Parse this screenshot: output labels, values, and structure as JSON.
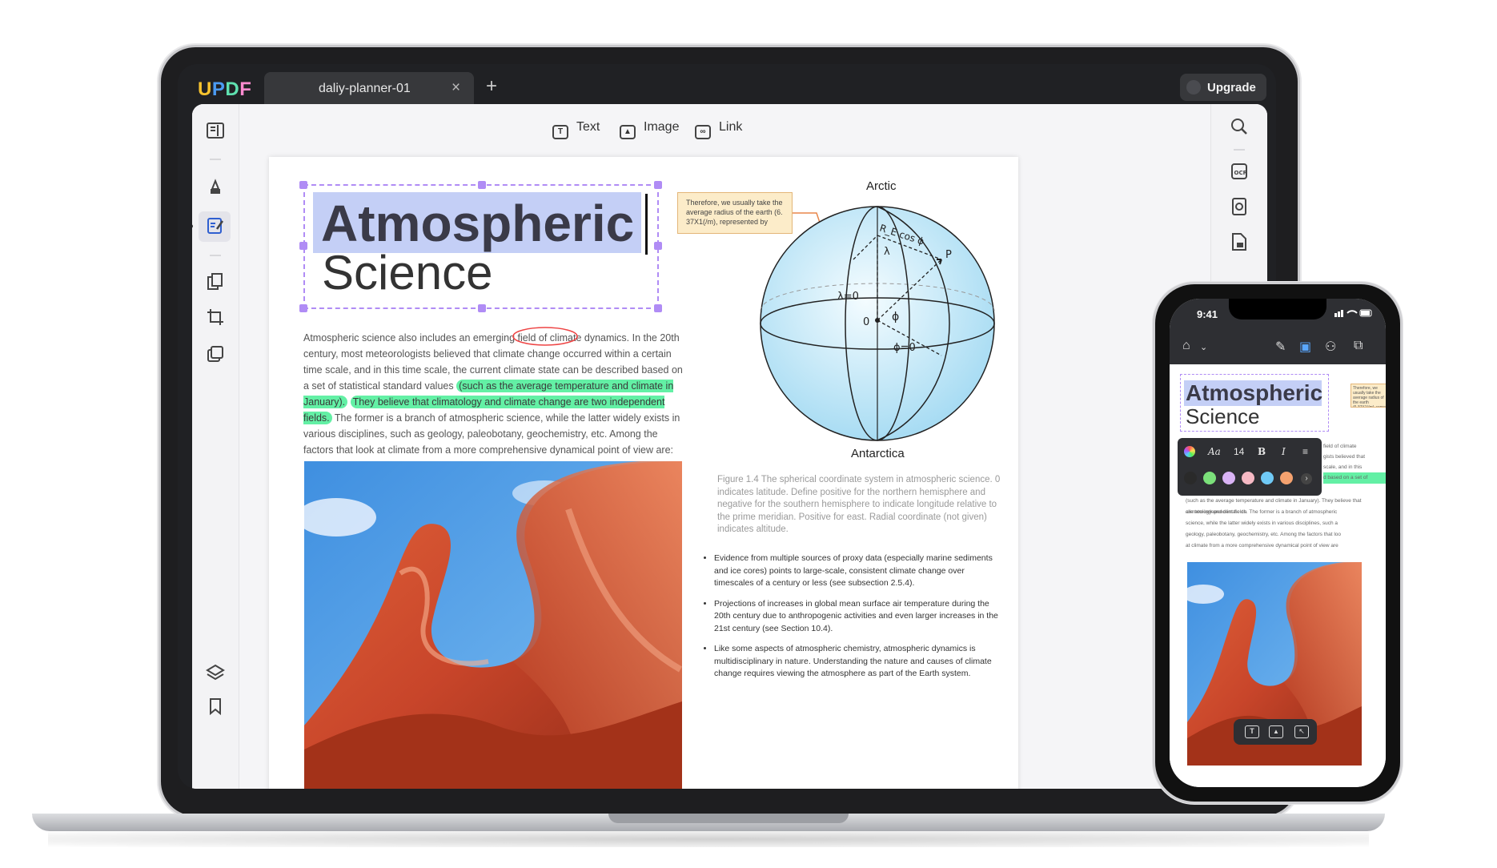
{
  "app": {
    "logo": [
      "U",
      "P",
      "D",
      "F"
    ],
    "logo_colors": [
      "#f7c32e",
      "#4b9bf3",
      "#5fe1b0",
      "#ff8bd0"
    ],
    "tab_title": "daliy-planner-01",
    "tab_close": "×",
    "tab_add": "+",
    "upgrade_label": "Upgrade"
  },
  "toolbar": {
    "text_label": "Text",
    "image_label": "Image",
    "link_label": "Link"
  },
  "document": {
    "title_line1": "Atmospheric",
    "title_line2": "Science",
    "paragraph": {
      "p1": "Atmospheric science also includes an emerging field of climate dynamics. In the 20th century, most meteorologists believed that climate change occurred within a certain time scale, and in this time scale, the current climate state can be described based on a set of statistical standard values ",
      "highlight1": "(such as the average temperature and climate in January).",
      "highlight2": "They believe that climatology and climate change are two independent fields.",
      "p2": " The former is a branch of atmospheric science, while the latter widely exists in various disciplines, such as geology, paleobotany, geochemistry, etc. Among the factors that look at climate from a more comprehensive dynamical point of view are:"
    },
    "callout": "Therefore, we usually take the average radius of the earth (6. 37X1(/m), represented by",
    "globe": {
      "top_label": "Arctic",
      "bottom_label": "Antarctica",
      "lambda0": "λ=0",
      "zero": "0",
      "phi": "ϕ",
      "phi0": "ϕ=0",
      "lambda": "λ",
      "p": "P",
      "recos": "R_E cos ϕ"
    },
    "caption": "Figure 1.4 The spherical coordinate system in atmospheric science. 0 indicates latitude. Define positive for the northern hemisphere and negative for the southern hemisphere to indicate longitude relative to the prime meridian. Positive for east. Radial coordinate (not given) indicates altitude.",
    "bullets": [
      "Evidence from multiple sources of proxy data (especially marine sediments and ice cores) points to large-scale, consistent climate change over timescales of a century or less (see subsection 2.5.4).",
      "Projections of increases in global mean surface air temperature during the 20th century due to anthropogenic activities and even larger increases in the 21st century (see Section 10.4).",
      "Like some aspects of atmospheric chemistry, atmospheric dynamics is multidisciplinary in nature. Understanding the nature and causes of climate change requires viewing the atmosphere as part of the Earth system."
    ]
  },
  "phone": {
    "time": "9:41",
    "title_line1": "Atmospheric",
    "title_line2": "Science",
    "font_label": "Aa",
    "font_size": "14",
    "bold": "B",
    "italic": "I",
    "swatches": [
      "#2a2a2a",
      "#7be07a",
      "#d9b3f5",
      "#f6b9c4",
      "#6fc9f5",
      "#f5a26f"
    ],
    "text_lines": [
      "field of climate",
      "gists believed that",
      "scale, and in this",
      "d based on a set of",
      "(such as the average temperature and climate in January). They believe that climatology and climate ch",
      "are two independent fields. The former is a branch of atmospheric",
      "science, while the latter widely exists in various disciplines, such a",
      "geology, paleobotany, geochemistry, etc. Among the factors that loo",
      "at climate from a more comprehensive dynamical point of view are"
    ],
    "callout": "Therefore, we usually take the average radius of the earth (6.37X1(/m), repre"
  }
}
